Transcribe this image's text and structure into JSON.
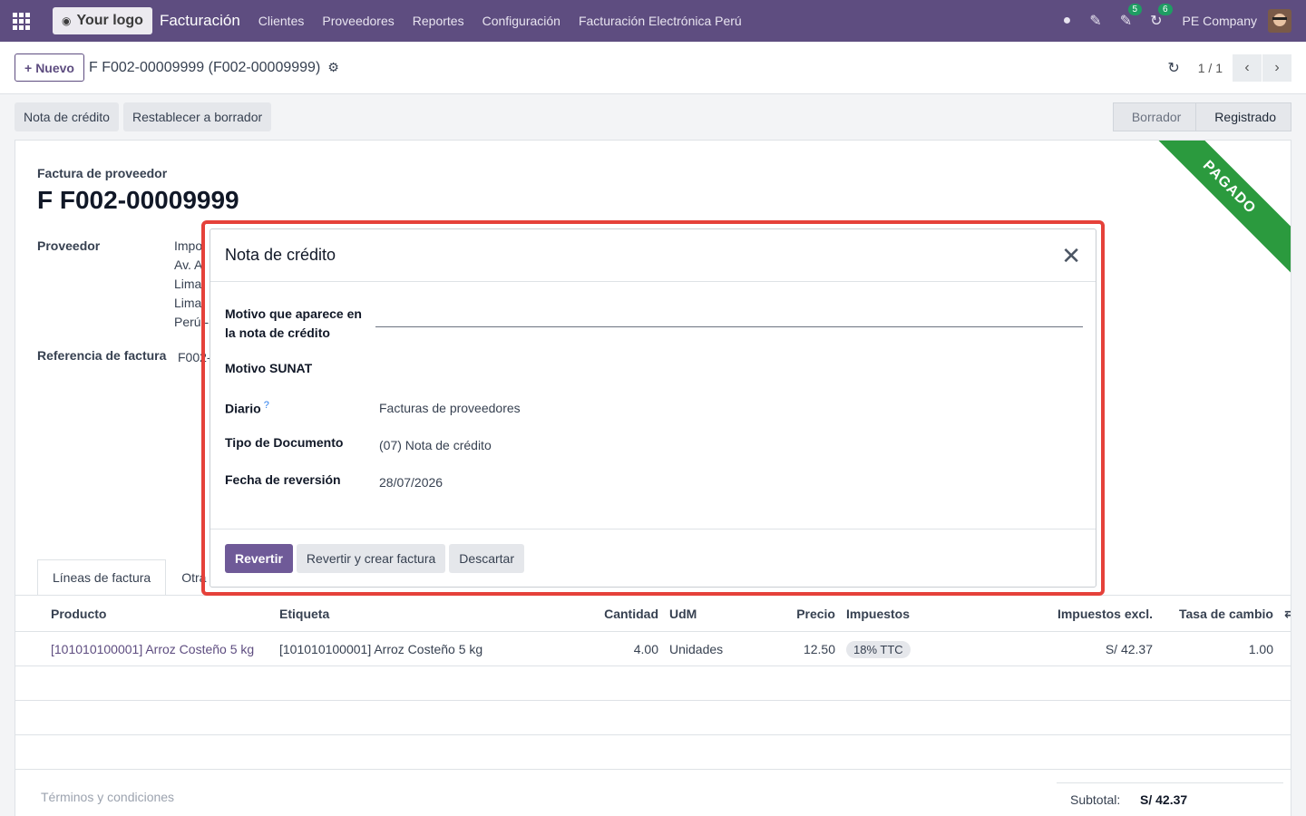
{
  "navbar": {
    "logo": "Your logo",
    "app": "Facturación",
    "menu": [
      "Clientes",
      "Proveedores",
      "Reportes",
      "Configuración",
      "Facturación Electrónica Perú"
    ],
    "chat_count": "5",
    "activity_count": "6",
    "company": "PE Company"
  },
  "control_panel": {
    "new_label": "Nuevo",
    "breadcrumb": "F F002-00009999 (F002-00009999)",
    "pager": "1 / 1"
  },
  "statusbar": {
    "buttons": [
      "Nota de crédito",
      "Restablecer a borrador"
    ],
    "stages": [
      "Borrador",
      "Registrado"
    ]
  },
  "sheet": {
    "ribbon": "PAGADO",
    "doc_type": "Factura de proveedor",
    "doc_name": "F F002-00009999",
    "vendor_label": "Proveedor",
    "vendor_lines": [
      "Impo",
      "Av. A",
      "Lima",
      "Lima",
      "Perú -"
    ],
    "ref_label": "Referencia de factura",
    "ref_value": "F002-",
    "tabs": [
      "Líneas de factura",
      "Otra i"
    ],
    "columns": [
      "Producto",
      "Etiqueta",
      "Cantidad",
      "UdM",
      "Precio",
      "Impuestos",
      "Impuestos excl.",
      "Tasa de cambio"
    ],
    "rows": [
      {
        "product": "[101010100001] Arroz Costeño 5 kg",
        "label": "[101010100001] Arroz Costeño 5 kg",
        "qty": "4.00",
        "udm": "Unidades",
        "price": "12.50",
        "tax": "18% TTC",
        "excl": "S/ 42.37",
        "rate": "1.00"
      }
    ],
    "terms": "Términos y condiciones",
    "subtotal_label": "Subtotal:",
    "subtotal_value": "S/ 42.37"
  },
  "modal": {
    "title": "Nota de crédito",
    "reason_label": "Motivo que aparece en la nota de crédito",
    "reason_value": "",
    "sunat_label": "Motivo SUNAT",
    "journal_label": "Diario",
    "journal_help": "?",
    "journal_value": "Facturas de proveedores",
    "doc_type_label": "Tipo de Documento",
    "doc_type_value": "(07) Nota de crédito",
    "date_label": "Fecha de reversión",
    "date_value": "28/07/2026",
    "buttons": {
      "revert": "Revertir",
      "revert_create": "Revertir y crear factura",
      "discard": "Descartar"
    }
  },
  "colors": {
    "brand": "#5e4d80",
    "primary_button": "#6f5a98",
    "ribbon": "#2b9a3e",
    "highlight": "#e5413a"
  }
}
